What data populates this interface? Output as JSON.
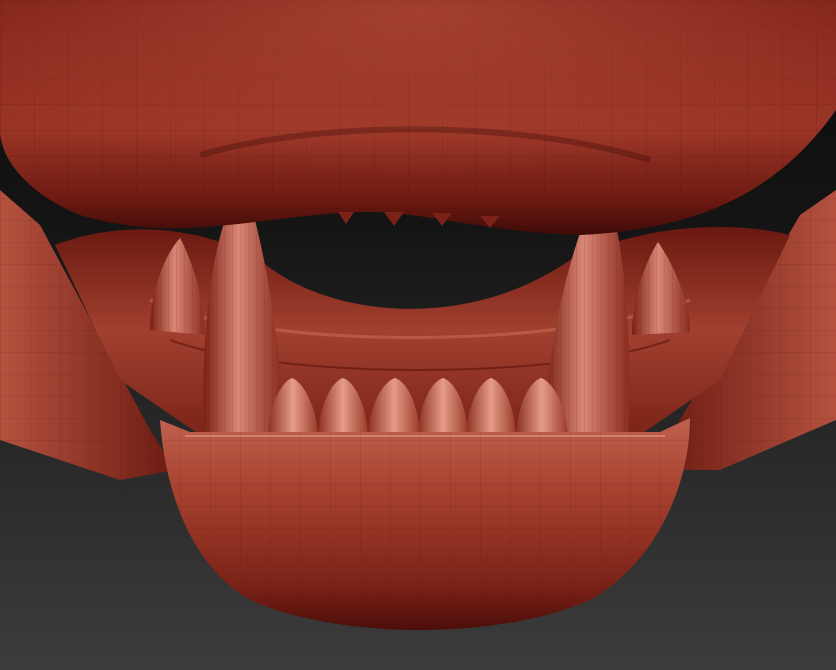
{
  "scene": {
    "subject": "sculpted-creature-jaw",
    "colors": {
      "background_top": "#0b0b0b",
      "background_bottom": "#3c3c3c",
      "clay_dark": "#4a0f0a",
      "clay_mid": "#8a2a1e",
      "clay_light": "#c4604d",
      "clay_highlight": "#e49a84"
    },
    "lower_front_teeth": 6,
    "upper_small_teeth": 4,
    "long_fangs": 2,
    "side_fangs": 2
  }
}
